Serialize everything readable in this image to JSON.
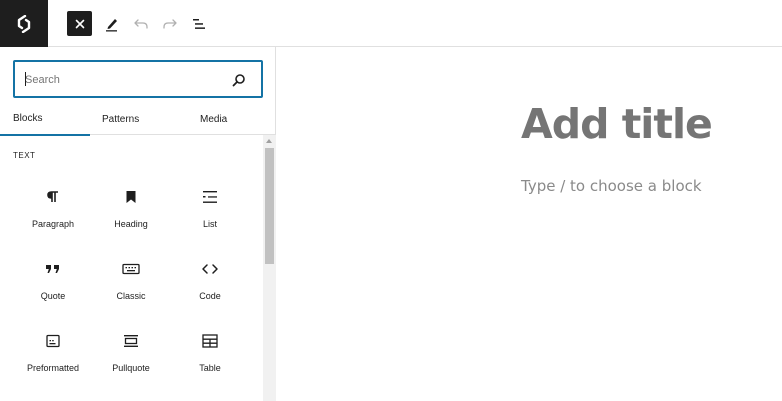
{
  "toolbar": {
    "logo_icon": "site-logo-icon",
    "close_icon": "close-icon",
    "tools_icon": "pen-icon",
    "undo_icon": "undo-icon",
    "redo_icon": "redo-icon",
    "document_overview_icon": "list-view-icon"
  },
  "inserter": {
    "search": {
      "placeholder": "Search",
      "value": ""
    },
    "tabs": [
      {
        "label": "Blocks",
        "active": true
      },
      {
        "label": "Patterns",
        "active": false
      },
      {
        "label": "Media",
        "active": false
      }
    ],
    "category": "TEXT",
    "blocks": [
      {
        "label": "Paragraph",
        "icon": "paragraph-icon"
      },
      {
        "label": "Heading",
        "icon": "heading-bookmark-icon"
      },
      {
        "label": "List",
        "icon": "list-icon"
      },
      {
        "label": "Quote",
        "icon": "quote-icon"
      },
      {
        "label": "Classic",
        "icon": "keyboard-icon"
      },
      {
        "label": "Code",
        "icon": "code-icon"
      },
      {
        "label": "Preformatted",
        "icon": "preformatted-icon"
      },
      {
        "label": "Pullquote",
        "icon": "pullquote-icon"
      },
      {
        "label": "Table",
        "icon": "table-icon"
      }
    ]
  },
  "editor": {
    "title_placeholder": "Add title",
    "appender_placeholder": "Type / to choose a block"
  },
  "colors": {
    "accent": "#1473a5",
    "dark": "#1e1e1e",
    "muted": "#757575"
  }
}
